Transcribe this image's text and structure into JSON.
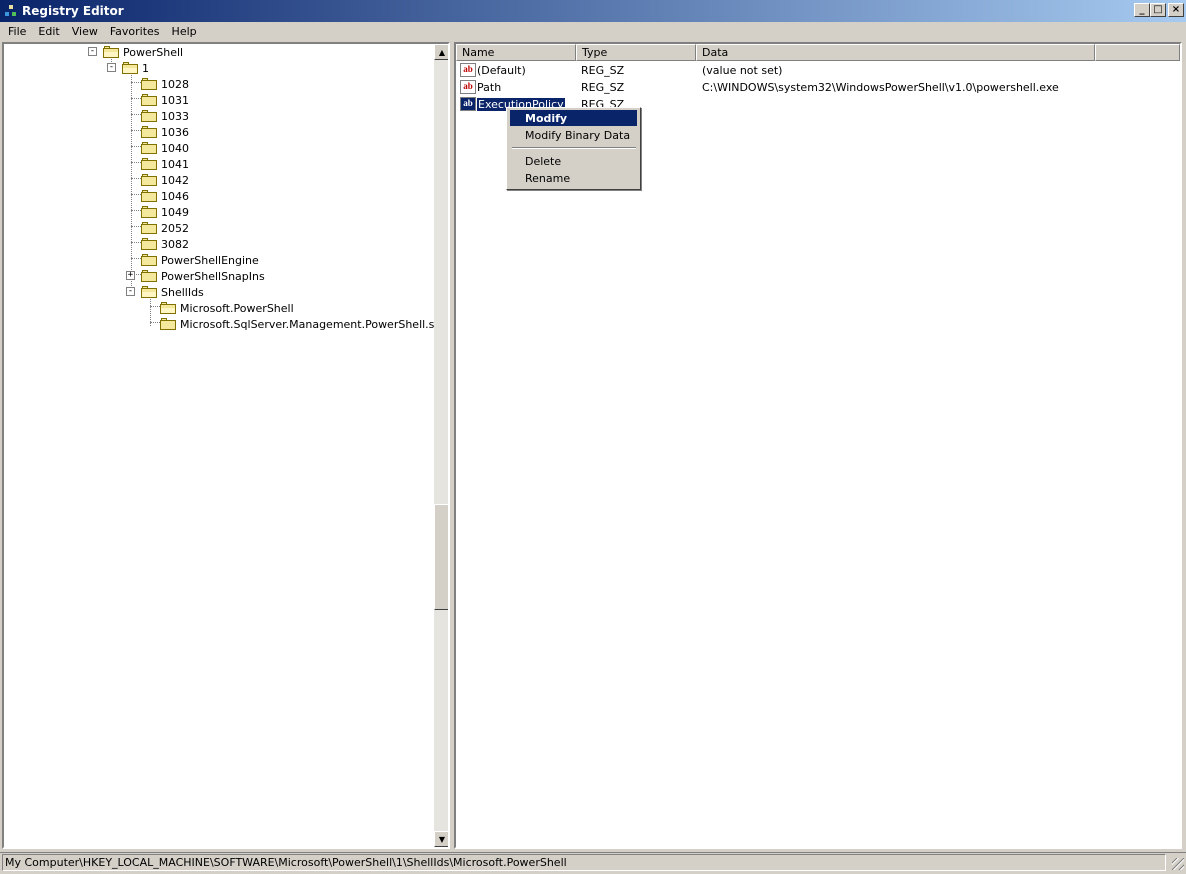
{
  "window": {
    "title": "Registry Editor",
    "minimize": "_",
    "maximize": "□",
    "close": "×"
  },
  "menu": [
    "File",
    "Edit",
    "View",
    "Favorites",
    "Help"
  ],
  "tree": {
    "nodes": [
      {
        "label": "PowerShell",
        "expander": "-"
      },
      {
        "label": "1",
        "expander": "-"
      },
      {
        "label": "1028"
      },
      {
        "label": "1031"
      },
      {
        "label": "1033"
      },
      {
        "label": "1036"
      },
      {
        "label": "1040"
      },
      {
        "label": "1041"
      },
      {
        "label": "1042"
      },
      {
        "label": "1046"
      },
      {
        "label": "1049"
      },
      {
        "label": "2052"
      },
      {
        "label": "3082"
      },
      {
        "label": "PowerShellEngine"
      },
      {
        "label": "PowerShellSnapIns",
        "expander": "+"
      },
      {
        "label": "ShellIds",
        "expander": "-"
      },
      {
        "label": "Microsoft.PowerShell"
      },
      {
        "label": "Microsoft.SqlServer.Management.PowerShell.sqlps"
      }
    ],
    "scroll_up": "▲",
    "scroll_down": "▼"
  },
  "list": {
    "columns": [
      "Name",
      "Type",
      "Data"
    ],
    "rows": [
      {
        "icon": "ab",
        "name": "(Default)",
        "type": "REG_SZ",
        "data": "(value not set)"
      },
      {
        "icon": "ab",
        "name": "Path",
        "type": "REG_SZ",
        "data": "C:\\WINDOWS\\system32\\WindowsPowerShell\\v1.0\\powershell.exe"
      },
      {
        "icon": "ab",
        "name": "ExecutionPolicy",
        "type": "REG_SZ",
        "data": ""
      }
    ]
  },
  "context_menu": {
    "items": [
      "Modify",
      "Modify Binary Data",
      "Delete",
      "Rename"
    ]
  },
  "status": {
    "path": "My Computer\\HKEY_LOCAL_MACHINE\\SOFTWARE\\Microsoft\\PowerShell\\1\\ShellIds\\Microsoft.PowerShell"
  }
}
